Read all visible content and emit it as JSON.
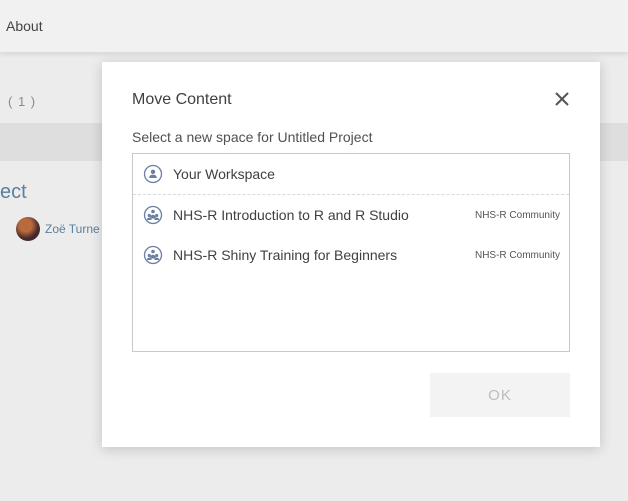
{
  "background": {
    "nav": {
      "about_label": "About"
    },
    "count_text": "( 1 )",
    "project_title_fragment": "ect",
    "author_name_fragment": "Zoë Turne"
  },
  "dialog": {
    "title": "Move Content",
    "subtitle": "Select a new space for Untitled Project",
    "spaces": [
      {
        "label": "Your Workspace",
        "owner": "",
        "icon": "user-icon"
      },
      {
        "label": "NHS-R Introduction to R and R Studio",
        "owner": "NHS-R Community",
        "icon": "group-icon"
      },
      {
        "label": "NHS-R Shiny Training for Beginners",
        "owner": "NHS-R Community",
        "icon": "group-icon"
      }
    ],
    "ok_label": "OK"
  },
  "colors": {
    "accent": "#5a7fa0",
    "icon": "#6b7fa3",
    "disabled_text": "#bdbdbd"
  }
}
